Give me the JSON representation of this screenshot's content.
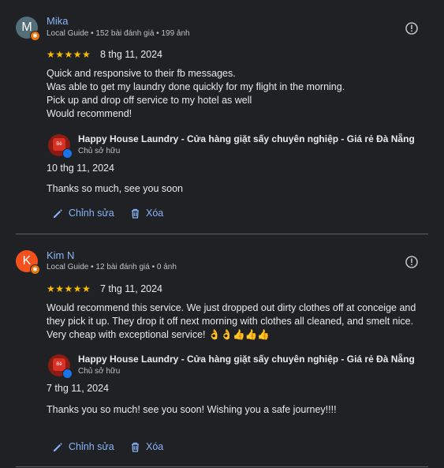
{
  "reviews": [
    {
      "avatar_letter": "M",
      "avatar_color": "#546e7a",
      "badge_color": "#e8710a",
      "name": "Mika",
      "meta": "Local Guide • 152 bài đánh giá • 199 ảnh",
      "stars": "★★★★★",
      "date": "8 thg 11, 2024",
      "text": "Quick and responsive to their fb messages.\nWas able to get my laundry done quickly for my flight in the morning.\nPick up and drop off service to my hotel as well\nWould recommend!",
      "reply": {
        "owner_name": "Happy House Laundry - Cửa hàng giặt sấy chuyên nghiệp - Giá rẻ Đà Nẵng",
        "owner_role": "Chủ sở hữu",
        "date": "10 thg 11, 2024",
        "text": "Thanks so much, see you soon"
      },
      "edit_label": "Chỉnh sửa",
      "delete_label": "Xóa"
    },
    {
      "avatar_letter": "K",
      "avatar_color": "#f4511e",
      "badge_color": "#e8710a",
      "name": "Kim N",
      "meta": "Local Guide • 12 bài đánh giá • 0 ảnh",
      "stars": "★★★★★",
      "date": "7 thg 11, 2024",
      "text": "Would recommend this service. We just dropped out dirty clothes off at conceige and they pick it up. They drop it off next morning with clothes all cleaned, and smelt nice. Very cheap with exceptional service! 👌👌👍👍👍",
      "reply": {
        "owner_name": "Happy House Laundry - Cửa hàng giặt sấy chuyên nghiệp - Giá rẻ Đà Nẵng",
        "owner_role": "Chủ sở hữu",
        "date": "7 thg 11, 2024",
        "text": "Thanks you so much! see you soon! Wishing you a safe journey!!!!"
      },
      "edit_label": "Chỉnh sửa",
      "delete_label": "Xóa"
    }
  ],
  "owner_avatar_text": "Bê"
}
